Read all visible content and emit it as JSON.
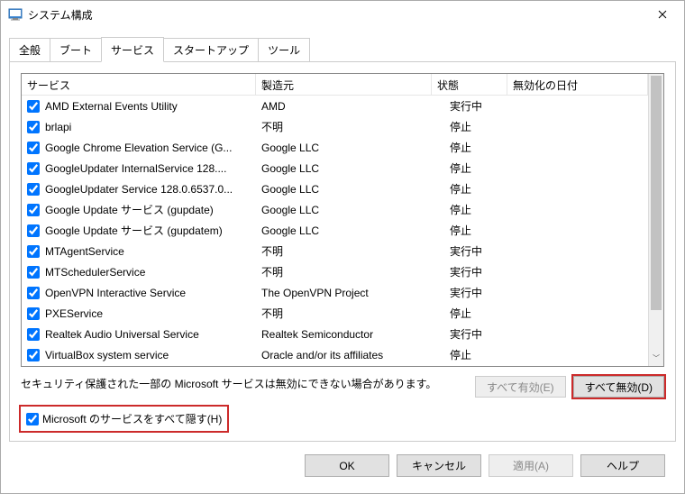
{
  "window": {
    "title": "システム構成"
  },
  "tabs": {
    "t0": "全般",
    "t1": "ブート",
    "t2": "サービス",
    "t3": "スタートアップ",
    "t4": "ツール"
  },
  "columns": {
    "service": "サービス",
    "maker": "製造元",
    "state": "状態",
    "date": "無効化の日付"
  },
  "services": [
    {
      "name": "AMD External Events Utility",
      "maker": "AMD",
      "state": "実行中"
    },
    {
      "name": "brlapi",
      "maker": "不明",
      "state": "停止"
    },
    {
      "name": "Google Chrome Elevation Service (G...",
      "maker": "Google LLC",
      "state": "停止"
    },
    {
      "name": "GoogleUpdater InternalService 128....",
      "maker": "Google LLC",
      "state": "停止"
    },
    {
      "name": "GoogleUpdater Service 128.0.6537.0...",
      "maker": "Google LLC",
      "state": "停止"
    },
    {
      "name": "Google Update サービス (gupdate)",
      "maker": "Google LLC",
      "state": "停止"
    },
    {
      "name": "Google Update サービス (gupdatem)",
      "maker": "Google LLC",
      "state": "停止"
    },
    {
      "name": "MTAgentService",
      "maker": "不明",
      "state": "実行中"
    },
    {
      "name": "MTSchedulerService",
      "maker": "不明",
      "state": "実行中"
    },
    {
      "name": "OpenVPN Interactive Service",
      "maker": "The OpenVPN Project",
      "state": "実行中"
    },
    {
      "name": "PXEService",
      "maker": "不明",
      "state": "停止"
    },
    {
      "name": "Realtek Audio Universal Service",
      "maker": "Realtek Semiconductor",
      "state": "実行中"
    },
    {
      "name": "VirtualBox system service",
      "maker": "Oracle and/or its affiliates",
      "state": "停止"
    }
  ],
  "note": "セキュリティ保護された一部の Microsoft サービスは無効にできない場合があります。",
  "buttons": {
    "enable_all": "すべて有効(E)",
    "disable_all": "すべて無効(D)",
    "hide_ms": "Microsoft のサービスをすべて隠す(H)",
    "ok": "OK",
    "cancel": "キャンセル",
    "apply": "適用(A)",
    "help": "ヘルプ"
  }
}
